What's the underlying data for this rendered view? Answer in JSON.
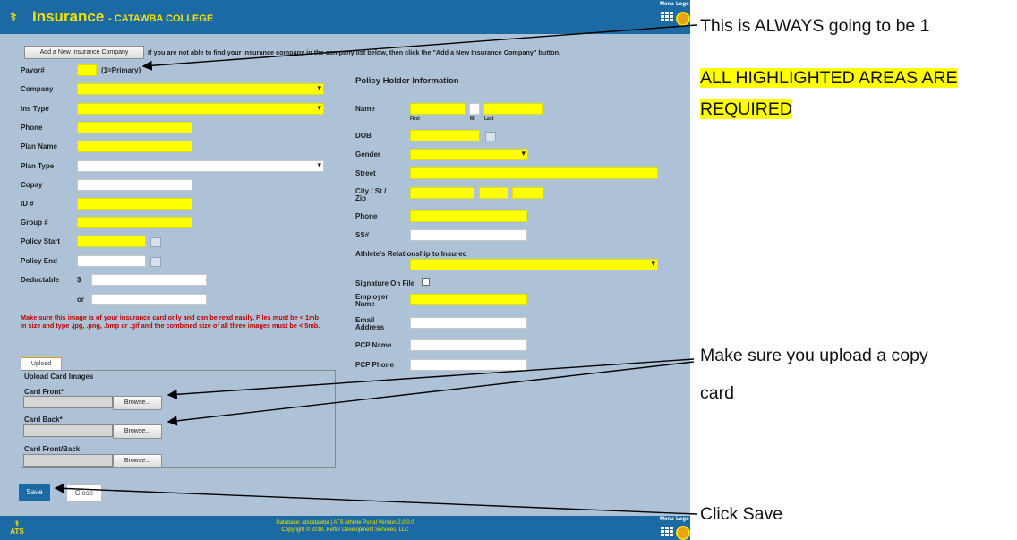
{
  "app": {
    "title": "Insurance",
    "subtitle": "- CATAWBA COLLEGE",
    "menu_label": "Menu",
    "logout_label": "Logo",
    "footer_line1": "Database: atscatawba | ATS Athlete Portal Version 2.0.0.0",
    "footer_line2": "Copyright © 2018, Keffer Development Services, LLC",
    "logo_text": "ATS",
    "accent_color": "#1c6aa3",
    "required_color": "#ffff00"
  },
  "toolbar": {
    "add_button": "Add a New Insurance Company",
    "add_hint": "If you are not able to find your insurance company in the company list below, then click the \"Add a New Insurance Company\" button."
  },
  "left": {
    "payor_label": "Payor#",
    "payor_hint": "(1=Primary)",
    "company_label": "Company",
    "ins_type_label": "Ins Type",
    "phone_label": "Phone",
    "plan_name_label": "Plan Name",
    "plan_type_label": "Plan Type",
    "copay_label": "Copay",
    "id_label": "ID #",
    "group_label": "Group #",
    "policy_start_label": "Policy Start",
    "policy_end_label": "Policy End",
    "deductable_label": "Deductable",
    "currency": "$",
    "or_label": "or"
  },
  "right": {
    "heading": "Policy Holder Information",
    "name_label": "Name",
    "first_label": "First",
    "mi_label": "MI",
    "last_label": "Last",
    "dob_label": "DOB",
    "gender_label": "Gender",
    "street_label": "Street",
    "city_label_1": "City / St /",
    "city_label_2": "Zip",
    "phone_label": "Phone",
    "ss_label": "SS#",
    "relationship_label": "Athlete's Relationship to Insured",
    "signature_label": "Signature On File",
    "employer_label_1": "Employer",
    "employer_label_2": "Name",
    "email_label_1": "Email",
    "email_label_2": "Address",
    "pcp_name_label": "PCP Name",
    "pcp_phone_label": "PCP Phone"
  },
  "upload": {
    "note": "Make sure this image is of your insurance card only and can be read easily. Files must be < 1mb in size and type .jpg, .png, .bmp or .gif and the combined size of all three images must be < 5mb.",
    "tab_label": "Upload",
    "section_title": "Upload Card Images",
    "front_label": "Card Front*",
    "back_label": "Card Back*",
    "front_back_label": "Card Front/Back",
    "browse_label": "Browse..."
  },
  "actions": {
    "save_label": "Save",
    "close_label": "Close"
  },
  "annotations": {
    "payor_note": "This is ALWAYS going to be 1",
    "required_line1": "ALL HIGHLIGHTED AREAS ARE",
    "required_line2": "REQUIRED",
    "upload_line1": "Make sure you upload a copy",
    "upload_line2": "card",
    "save_note": "Click Save"
  }
}
